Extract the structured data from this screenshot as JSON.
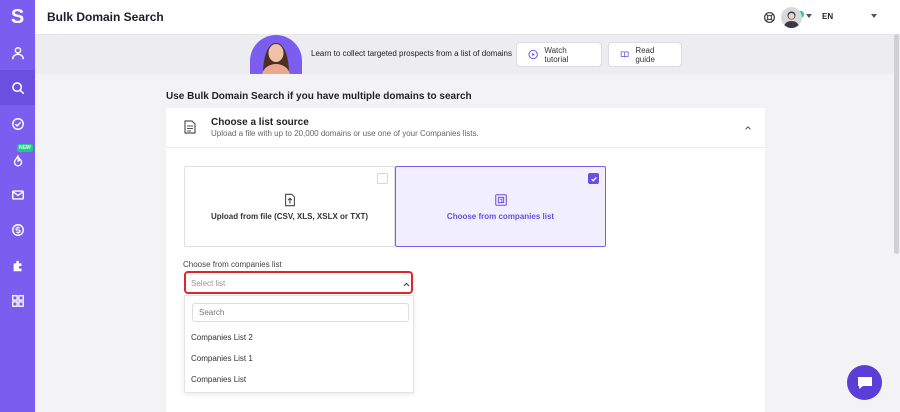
{
  "app": {
    "logo_letter": "S",
    "new_badge": "NEW"
  },
  "header": {
    "title": "Bulk Domain Search",
    "language": "EN"
  },
  "banner": {
    "text": "Learn to collect targeted prospects from a list of domains",
    "watch_tutorial": "Watch tutorial",
    "read_guide": "Read guide"
  },
  "section": {
    "title": "Use Bulk Domain Search if you have multiple domains to search"
  },
  "card": {
    "title": "Choose a list source",
    "subtitle": "Upload a file with up to 20,000 domains or use one of your Companies lists.",
    "option_upload": "Upload from file (CSV, XLS, XSLX or TXT)",
    "option_companies": "Choose from companies list"
  },
  "list_field": {
    "label": "Choose from companies list",
    "placeholder": "Select list",
    "search_placeholder": "Search",
    "options": [
      "Companies List 2",
      "Companies List 1",
      "Companies List"
    ]
  },
  "colors": {
    "accent": "#7b5ef0",
    "error_border": "#e0262a",
    "badge": "#21c98a"
  }
}
